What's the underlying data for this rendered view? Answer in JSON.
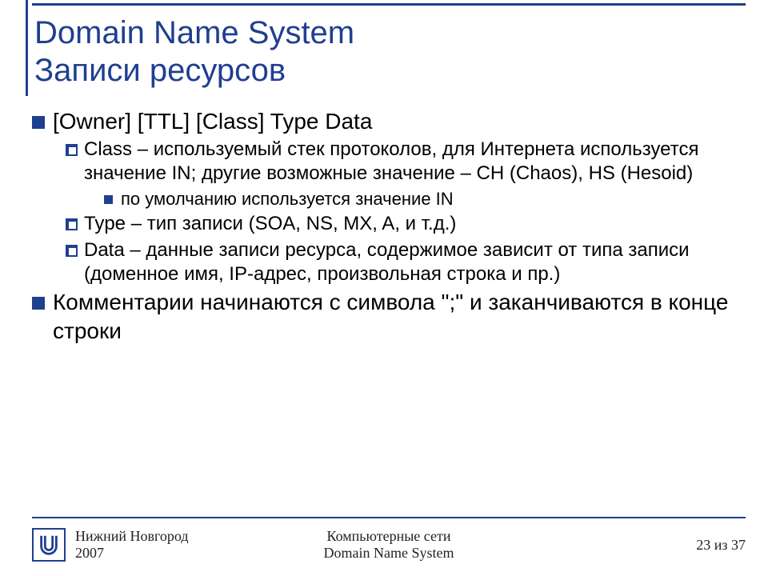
{
  "title": {
    "line1": "Domain Name System",
    "line2": "Записи ресурсов"
  },
  "body": {
    "item1": "[Owner]  [TTL]  [Class]  Type  Data",
    "sub1": "Class – используемый стек протоколов, для Интернета используется значение IN; другие возможные значение – CH (Chaos), HS (Hesoid)",
    "sub1a": "по умолчанию используется значение IN",
    "sub2": "Type – тип записи (SOA, NS, MX, A, и т.д.)",
    "sub3": "Data – данные записи ресурса, содержимое зависит от типа записи (доменное имя, IP-адрес, произвольная строка и пр.)",
    "item2": "Комментарии начинаются с символа \";\" и заканчиваются в конце строки"
  },
  "footer": {
    "left_line1": "Нижний Новгород",
    "left_line2": "2007",
    "center_line1": "Компьютерные сети",
    "center_line2": "Domain Name System",
    "page": "23 из 37"
  }
}
